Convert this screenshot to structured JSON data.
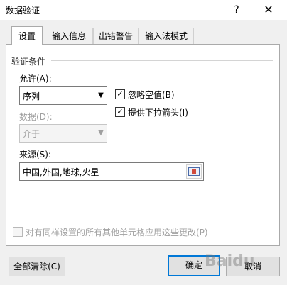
{
  "window": {
    "title": "数据验证",
    "help_label": "?",
    "close_label": "✕"
  },
  "tabs": [
    {
      "label": "设置",
      "active": true
    },
    {
      "label": "输入信息",
      "active": false
    },
    {
      "label": "出错警告",
      "active": false
    },
    {
      "label": "输入法模式",
      "active": false
    }
  ],
  "validation": {
    "group_title": "验证条件",
    "allow_label": "允许(A):",
    "allow_value": "序列",
    "data_label": "数据(D):",
    "data_value": "介于",
    "ignore_blank_label": "忽略空值(B)",
    "ignore_blank_checked": "✓",
    "dropdown_label": "提供下拉箭头(I)",
    "dropdown_checked": "✓",
    "source_label": "来源(S):",
    "source_value": "中国,外国,地球,火星",
    "apply_all_label": "对有同样设置的所有其他单元格应用这些更改(P)"
  },
  "buttons": {
    "clear_all": "全部清除(C)",
    "ok": "确定",
    "cancel": "取消"
  },
  "watermark": "Baidu"
}
